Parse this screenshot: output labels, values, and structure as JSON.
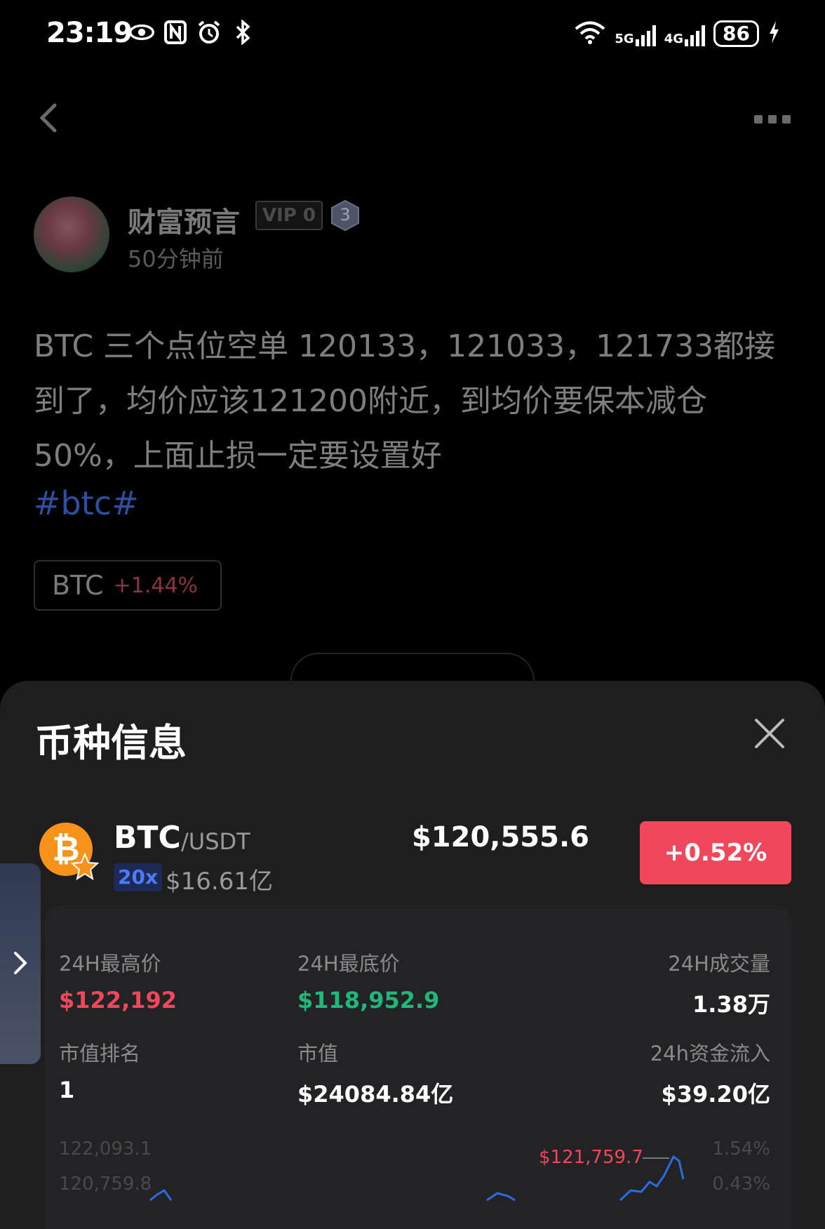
{
  "status_bar": {
    "time": "23:19",
    "network_1": "5G",
    "network_2": "4G",
    "battery": "86"
  },
  "post": {
    "author": "财富预言",
    "vip": "VIP 0",
    "level": "3",
    "time_ago": "50分钟前",
    "body": "BTC 三个点位空单 120133，121033，121733都接到了，均价应该121200附近，到均价要保本减仓50%，上面止损一定要设置好",
    "hashtag": "#btc#",
    "coin_chip": {
      "symbol": "BTC",
      "change": "+1.44%"
    }
  },
  "sheet": {
    "title": "币种信息",
    "coin": {
      "symbol": "BTC",
      "quote": "/USDT",
      "leverage": "20x",
      "mcap_short": "$16.61亿",
      "price": "$120,555.6",
      "change": "+0.52%"
    },
    "stats": {
      "high_label": "24H最高价",
      "high_value": "$122,192",
      "low_label": "24H最底价",
      "low_value": "$118,952.9",
      "volume_label": "24H成交量",
      "volume_value": "1.38万",
      "rank_label": "市值排名",
      "rank_value": "1",
      "mcap_label": "市值",
      "mcap_value": "$24084.84亿",
      "inflow_label": "24h资金流入",
      "inflow_value": "$39.20亿"
    },
    "chart": {
      "y_left_top": "122,093.1",
      "y_left_second": "120,759.8",
      "y_right_top": "1.54%",
      "y_right_second": "0.43%",
      "peak_label": "$121,759.7"
    }
  },
  "colors": {
    "up": "#f0475c",
    "down": "#20b77a",
    "accent": "#4d7bff",
    "btc": "#f7931a"
  }
}
